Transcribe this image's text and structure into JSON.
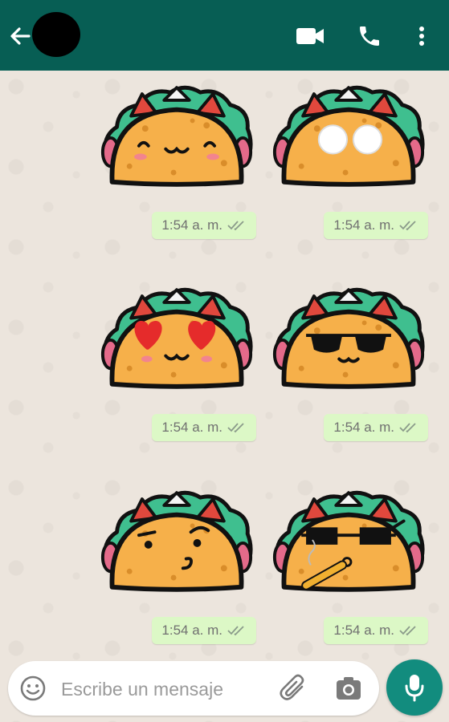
{
  "header": {
    "contact_avatar": "redacted-avatar",
    "icons": [
      "arrow-left-icon",
      "video-camera-icon",
      "phone-icon",
      "more-vert-icon"
    ],
    "bar_color": "#075e54"
  },
  "messages": [
    {
      "sticker": "taco-blushing-face",
      "time": "1:54 a. m.",
      "status": "read-double-check"
    },
    {
      "sticker": "taco-big-eyes",
      "time": "1:54 a. m.",
      "status": "read-double-check"
    },
    {
      "sticker": "taco-heart-eyes",
      "time": "1:54 a. m.",
      "status": "read-double-check"
    },
    {
      "sticker": "taco-sunglasses",
      "time": "1:54 a. m.",
      "status": "read-double-check"
    },
    {
      "sticker": "taco-smirk",
      "time": "1:54 a. m.",
      "status": "read-double-check"
    },
    {
      "sticker": "taco-cool-cigar",
      "time": "1:54 a. m.",
      "status": "read-double-check"
    }
  ],
  "composer": {
    "placeholder": "Escribe un mensaje",
    "icons": [
      "emoji-icon",
      "paperclip-icon",
      "camera-icon",
      "microphone-icon"
    ]
  },
  "colors": {
    "bubble": "#dcf8c6",
    "mic_button": "#128c7e",
    "wallpaper": "#ece5dd"
  }
}
